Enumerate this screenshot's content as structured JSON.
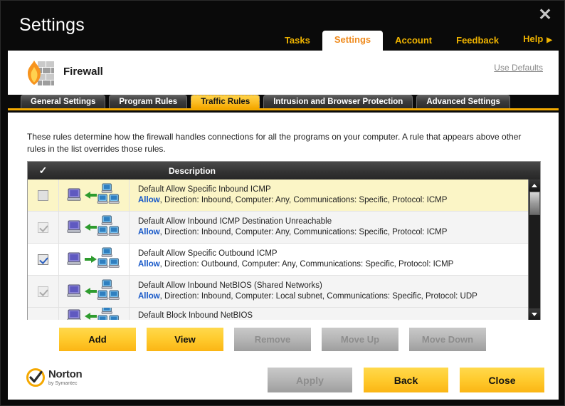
{
  "window": {
    "title": "Settings",
    "close_label": "✕"
  },
  "topnav": {
    "items": [
      {
        "label": "Tasks",
        "active": false
      },
      {
        "label": "Settings",
        "active": true
      },
      {
        "label": "Account",
        "active": false
      },
      {
        "label": "Feedback",
        "active": false
      },
      {
        "label": "Help",
        "active": false,
        "caret": "▶"
      }
    ]
  },
  "feature": {
    "name": "Firewall",
    "use_defaults": "Use Defaults"
  },
  "tabs": [
    {
      "label": "General Settings",
      "active": false
    },
    {
      "label": "Program Rules",
      "active": false
    },
    {
      "label": "Traffic Rules",
      "active": true
    },
    {
      "label": "Intrusion and Browser Protection",
      "active": false
    },
    {
      "label": "Advanced Settings",
      "active": false
    }
  ],
  "main": {
    "intro": "These rules determine how the firewall handles connections for all the programs on your computer. A rule that appears above other rules in the list overrides those rules.",
    "table": {
      "header_check": "✓",
      "header_description": "Description",
      "rows": [
        {
          "title": "Default Allow Specific Inbound ICMP",
          "verb": "Allow",
          "meta": ", Direction: Inbound, Computer: Any, Communications: Specific, Protocol: ICMP",
          "direction": "inbound",
          "checkbox": "empty-selected",
          "row_state": "selected"
        },
        {
          "title": "Default Allow Inbound ICMP Destination Unreachable",
          "verb": "Allow",
          "meta": ", Direction: Inbound, Computer: Any, Communications: Specific, Protocol: ICMP",
          "direction": "inbound",
          "checkbox": "checked-disabled",
          "row_state": "alt"
        },
        {
          "title": "Default Allow Specific Outbound ICMP",
          "verb": "Allow",
          "meta": ", Direction: Outbound, Computer: Any, Communications: Specific, Protocol: ICMP",
          "direction": "outbound",
          "checkbox": "checked-active",
          "row_state": "normal"
        },
        {
          "title": "Default Allow Inbound NetBIOS (Shared Networks)",
          "verb": "Allow",
          "meta": ", Direction: Inbound, Computer: Local subnet, Communications: Specific, Protocol: UDP",
          "direction": "inbound",
          "checkbox": "checked-disabled",
          "row_state": "alt"
        },
        {
          "title": "Default Block Inbound NetBIOS",
          "verb": "",
          "meta": "",
          "direction": "inbound",
          "checkbox": "checked-disabled",
          "row_state": "partial"
        }
      ]
    },
    "actions": [
      {
        "label": "Add",
        "disabled": false
      },
      {
        "label": "View",
        "disabled": false
      },
      {
        "label": "Remove",
        "disabled": true
      },
      {
        "label": "Move Up",
        "disabled": true
      },
      {
        "label": "Move Down",
        "disabled": true
      }
    ]
  },
  "footer": {
    "brand_main": "Norton",
    "brand_sub": "by Symantec",
    "buttons": [
      {
        "label": "Apply",
        "disabled": true
      },
      {
        "label": "Back",
        "disabled": false
      },
      {
        "label": "Close",
        "disabled": false
      }
    ]
  },
  "colors": {
    "accent_yellow": "#f2a900",
    "nav_orange": "#ef8b1e",
    "link_blue": "#1758c8",
    "selected_row": "#fbf5c6"
  }
}
